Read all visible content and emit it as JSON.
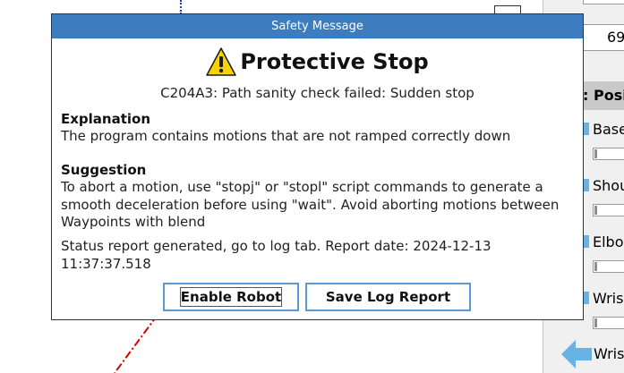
{
  "dialog": {
    "title": "Safety Message",
    "heading": "Protective Stop",
    "error_code": "C204A3: Path sanity check failed: Sudden stop",
    "explanation_heading": "Explanation",
    "explanation_text": "The program contains motions that are not ramped correctly down",
    "suggestion_heading": "Suggestion",
    "suggestion_text": "To abort a motion, use \"stopj\" or \"stopl\" script commands to generate a smooth deceleration before using \"wait\". Avoid aborting motions between Waypoints with blend",
    "status_text": "Status report generated, go to log tab. Report date: 2024-12-13 11:37:37.518",
    "enable_button": "Enable Robot",
    "save_log_button": "Save Log Report",
    "icon": "warning-icon"
  },
  "right_panel": {
    "field_value": "69",
    "header": ": Posi",
    "joints": [
      {
        "label": "Base"
      },
      {
        "label": "Shou"
      },
      {
        "label": "Elbo"
      },
      {
        "label": "Wris"
      }
    ],
    "bottom_label": "Wris",
    "bottom_icon": "arrow-left-icon"
  },
  "colors": {
    "titlebar": "#3d7dbf",
    "button_border": "#5b9bd5",
    "joint_tab": "#68b3e6",
    "warning_yellow": "#f5d400",
    "path_red": "#d40000",
    "path_blue": "#1f3fb5"
  }
}
